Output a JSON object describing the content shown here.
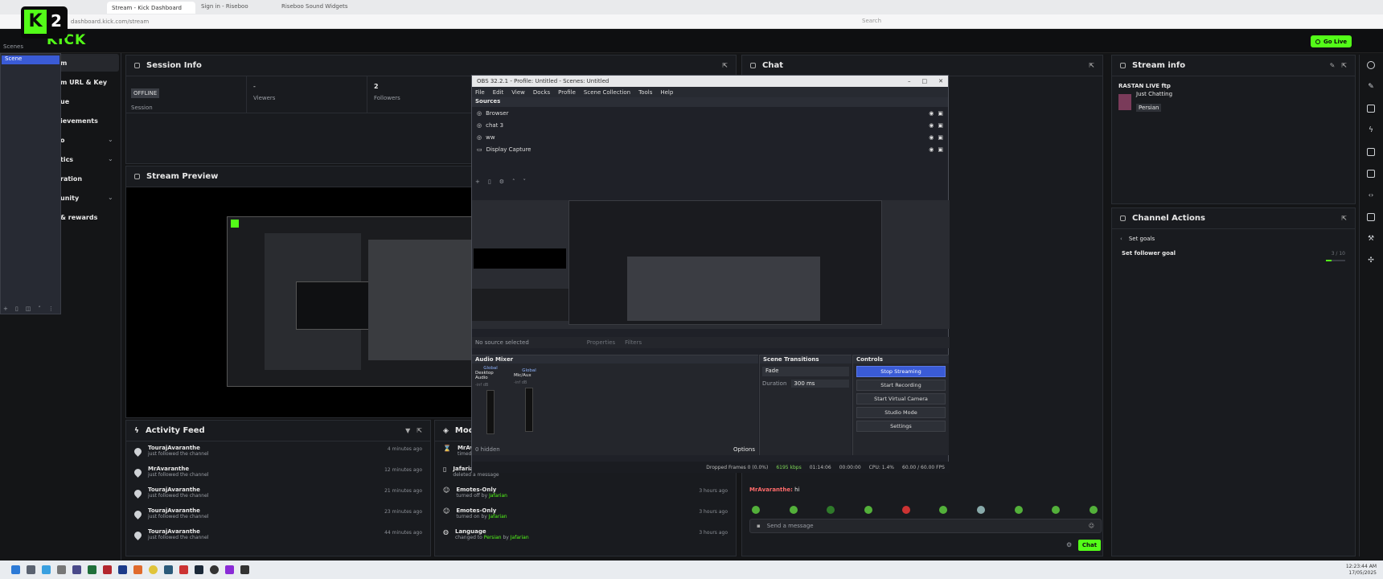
{
  "browser": {
    "tabs": [
      "Stream - Kick Dashboard",
      "Sign in - Riseboo",
      "Riseboo Sound Widgets"
    ],
    "url": "dashboard.kick.com/stream",
    "search_placeholder": "Search"
  },
  "kick": {
    "logo": "KICK",
    "overlay_number": "2",
    "go_live": "Go Live"
  },
  "sidebar": {
    "items": [
      "Stream",
      "Stream URL & Key",
      "Queue",
      "Achievements",
      "Community",
      "Analytics",
      "Moderation",
      "Community",
      "Perks & rewards"
    ],
    "visible": [
      "m",
      "m URL & Key",
      "ue",
      "ievements",
      "o",
      "tics",
      "ration",
      "unity",
      "& rewards"
    ]
  },
  "scene_dock": {
    "label": "Scenes",
    "item": "Scene"
  },
  "session_info": {
    "title": "Session Info",
    "status_badge": "OFFLINE",
    "session_label": "Session",
    "viewers_value": "-",
    "viewers_label": "Viewers",
    "followers_value": "2",
    "followers_label": "Followers"
  },
  "chat": {
    "title": "Chat",
    "message_user": "MrAvaranthe:",
    "message_text": "hi",
    "input_placeholder": "Send a message",
    "send_label": "Chat"
  },
  "stream_info": {
    "title": "Stream info",
    "stream_title": "RASTAN LIVE ftp",
    "category": "Just Chatting",
    "language_tag": "Persian"
  },
  "channel_actions": {
    "title": "Channel Actions",
    "back_label": "Set goals",
    "goal_label": "Set follower goal",
    "goal_progress_text": "3 / 10",
    "goal_progress": 0.3
  },
  "stream_preview": {
    "title": "Stream Preview"
  },
  "activity_feed": {
    "title": "Activity Feed",
    "items": [
      {
        "user": "TourajAvaranthe",
        "action": "just followed the channel",
        "time": "4 minutes ago"
      },
      {
        "user": "MrAvaranthe",
        "action": "just followed the channel",
        "time": "12 minutes ago"
      },
      {
        "user": "TourajAvaranthe",
        "action": "just followed the channel",
        "time": "21 minutes ago"
      },
      {
        "user": "TourajAvaranthe",
        "action": "just followed the channel",
        "time": "23 minutes ago"
      },
      {
        "user": "TourajAvaranthe",
        "action": "just followed the channel",
        "time": "44 minutes ago"
      }
    ]
  },
  "mod_log": {
    "title": "Mod",
    "items": [
      {
        "title": "MrAvar",
        "sub": "timed o",
        "time": ""
      },
      {
        "title": "Jafarian",
        "sub": "deleted a message",
        "time": ""
      },
      {
        "title": "Emotes-Only",
        "sub": "turned off by",
        "by": "Jafarian",
        "time": "3 hours ago"
      },
      {
        "title": "Emotes-Only",
        "sub": "turned on by",
        "by": "Jafarian",
        "time": "3 hours ago"
      },
      {
        "title": "Language",
        "sub": "changed to",
        "lang": "Persian",
        "by_prefix": "by",
        "by": "Jafarian",
        "time": "3 hours ago"
      }
    ]
  },
  "obs": {
    "title": "OBS 32.2.1 - Profile: Untitled - Scenes: Untitled",
    "menu": [
      "File",
      "Edit",
      "View",
      "Docks",
      "Profile",
      "Scene Collection",
      "Tools",
      "Help"
    ],
    "sources_title": "Sources",
    "sources": [
      "Browser",
      "chat 3",
      "ww",
      "Display Capture"
    ],
    "no_source": "No source selected",
    "properties": "Properties",
    "filters": "Filters",
    "audio_mixer_title": "Audio Mixer",
    "mixer_channels": [
      {
        "tag": "Global",
        "name": "Desktop Audio",
        "level": "-inf dB"
      },
      {
        "tag": "Global",
        "name": "Mic/Aux",
        "level": "-inf dB"
      }
    ],
    "hidden": "0 hidden",
    "options": "Options",
    "scene_transitions_title": "Scene Transitions",
    "transition": "Fade",
    "duration_label": "Duration",
    "duration_value": "300 ms",
    "controls_title": "Controls",
    "controls": [
      "Stop Streaming",
      "Start Recording",
      "Start Virtual Camera",
      "Studio Mode",
      "Settings"
    ],
    "status": {
      "dropped": "Dropped Frames 0 (0.0%)",
      "bitrate": "6195 kbps",
      "live_time": "01:14:06",
      "rec_time": "00:00:00",
      "cpu": "CPU: 1.4%",
      "fps": "60.00 / 60.00 FPS"
    }
  },
  "taskbar": {
    "time": "12:23:44 AM",
    "date": "17/05/2025"
  },
  "colors": {
    "kick_green": "#53fc18",
    "obs_blue": "#3a5bd6",
    "panel_bg": "#191b1f"
  }
}
